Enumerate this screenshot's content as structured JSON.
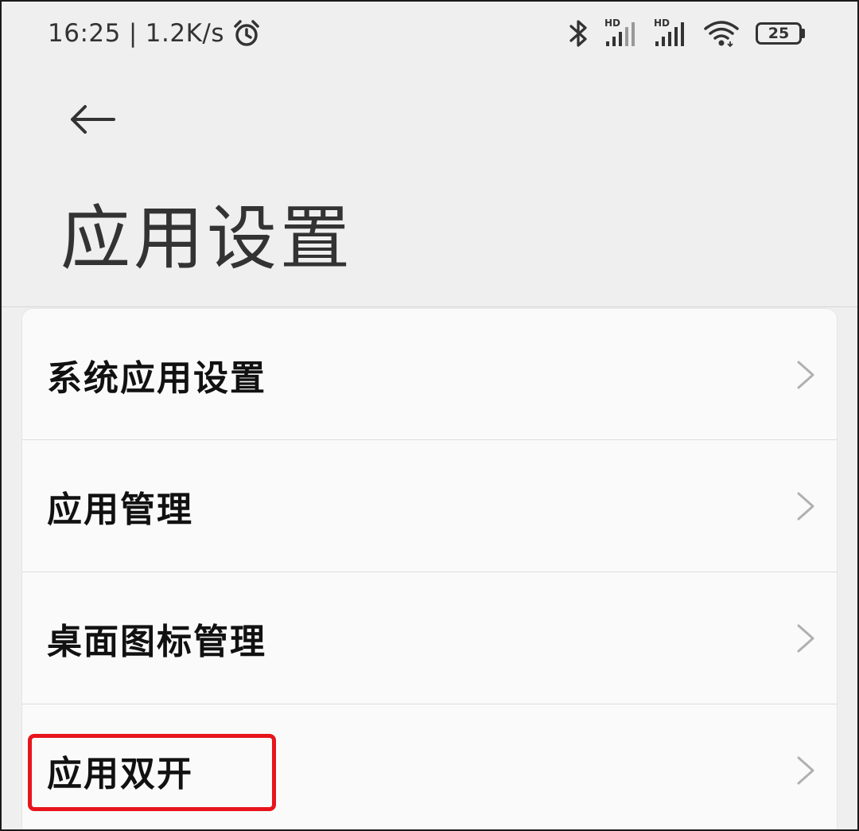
{
  "status_bar": {
    "time": "16:25",
    "separator": "|",
    "network_speed": "1.2K/s",
    "alarm_icon": "alarm-clock-icon",
    "signal_1_label": "HD",
    "signal_2_label": "HD",
    "battery_level": "25"
  },
  "header": {
    "back_icon": "arrow-left-icon",
    "title": "应用设置"
  },
  "menu": {
    "items": [
      {
        "label": "系统应用设置"
      },
      {
        "label": "应用管理"
      },
      {
        "label": "桌面图标管理"
      },
      {
        "label": "应用双开"
      }
    ]
  },
  "colors": {
    "background": "#efefef",
    "card": "#fafafa",
    "highlight": "#e8141c"
  }
}
